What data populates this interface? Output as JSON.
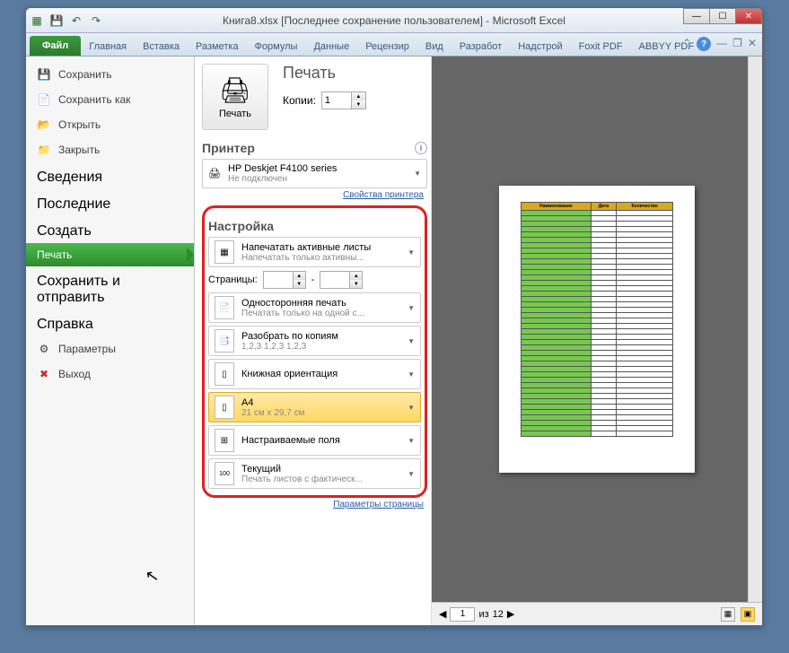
{
  "title": "Книга8.xlsx [Последнее сохранение пользователем] - Microsoft Excel",
  "tabs": {
    "file": "Файл",
    "home": "Главная",
    "insert": "Вставка",
    "layout": "Разметка",
    "formulas": "Формулы",
    "data": "Данные",
    "review": "Рецензир",
    "view": "Вид",
    "developer": "Разработ",
    "addins": "Надстрой",
    "foxit": "Foxit PDF",
    "abbyy": "ABBYY PDF"
  },
  "sidebar": {
    "save": "Сохранить",
    "save_as": "Сохранить как",
    "open": "Открыть",
    "close": "Закрыть",
    "info": "Сведения",
    "recent": "Последние",
    "new": "Создать",
    "print": "Печать",
    "share": "Сохранить и отправить",
    "help": "Справка",
    "options": "Параметры",
    "exit": "Выход"
  },
  "print": {
    "header": "Печать",
    "button": "Печать",
    "copies_label": "Копии:",
    "copies_value": "1",
    "printer_section": "Принтер",
    "printer_name": "HP Deskjet F4100 series",
    "printer_status": "Не подключен",
    "printer_props": "Свойства принтера",
    "settings_section": "Настройка",
    "settings": {
      "what": {
        "title": "Напечатать активные листы",
        "sub": "Напечатать только активны..."
      },
      "pages_label": "Страницы:",
      "pages_sep": "-",
      "sides": {
        "title": "Односторонняя печать",
        "sub": "Печатать только на одной с..."
      },
      "collate": {
        "title": "Разобрать по копиям",
        "sub": "1,2,3   1,2,3   1,2,3"
      },
      "orientation": {
        "title": "Книжная ориентация"
      },
      "size": {
        "title": "A4",
        "sub": "21 см x 29,7 см"
      },
      "margins": {
        "title": "Настраиваемые поля"
      },
      "scale": {
        "title": "Текущий",
        "sub": "Печать листов с фактическ..."
      }
    },
    "page_setup": "Параметры страницы"
  },
  "preview": {
    "page_current": "1",
    "page_of_label": "из",
    "page_total": "12",
    "headers": [
      "Наименование",
      "Дата",
      "Количество"
    ]
  }
}
